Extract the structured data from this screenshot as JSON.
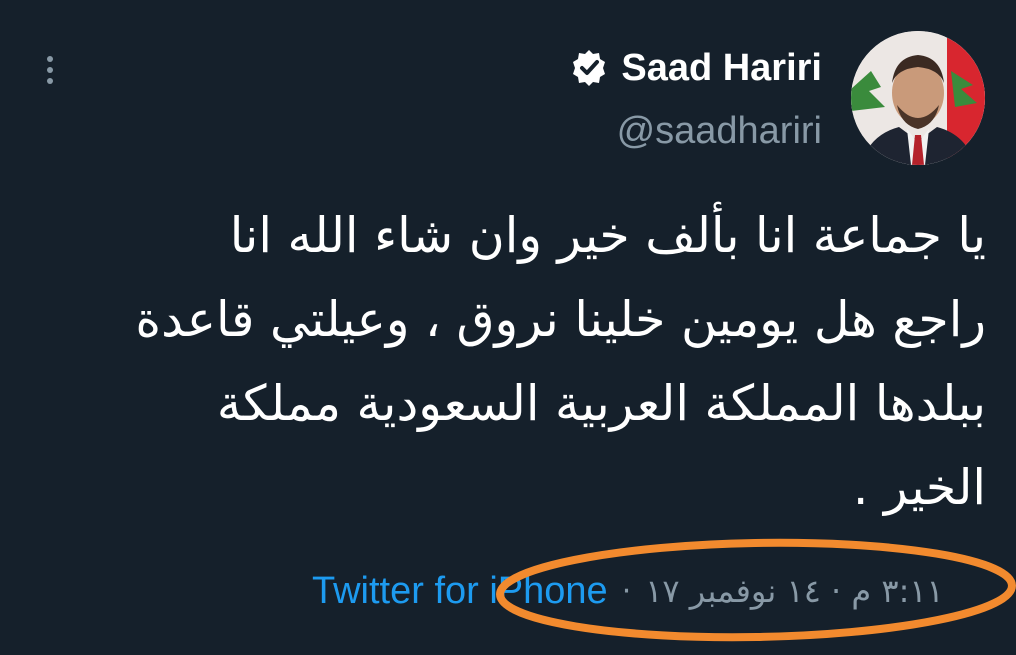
{
  "tweet": {
    "display_name": "Saad Hariri",
    "handle": "@saadhariri",
    "text_lines": [
      "يا جماعة انا بألف خير   وان شاء الله انا",
      "راجع هل يومين خلينا نروق ، وعيلتي قاعدة",
      "ببلدها المملكة العربية السعودية مملكة",
      "الخير ."
    ],
    "source": "Twitter for iPhone",
    "timestamp": "٣:١١ م · ١٤ نوفمبر ١٧"
  },
  "icons": {
    "more": "vertical-ellipsis-icon",
    "verified": "verified-badge-icon"
  },
  "colors": {
    "background": "#15202b",
    "text_primary": "#ffffff",
    "text_secondary": "#8899a6",
    "link": "#1d9bf0",
    "annotation": "#f28a2e"
  }
}
